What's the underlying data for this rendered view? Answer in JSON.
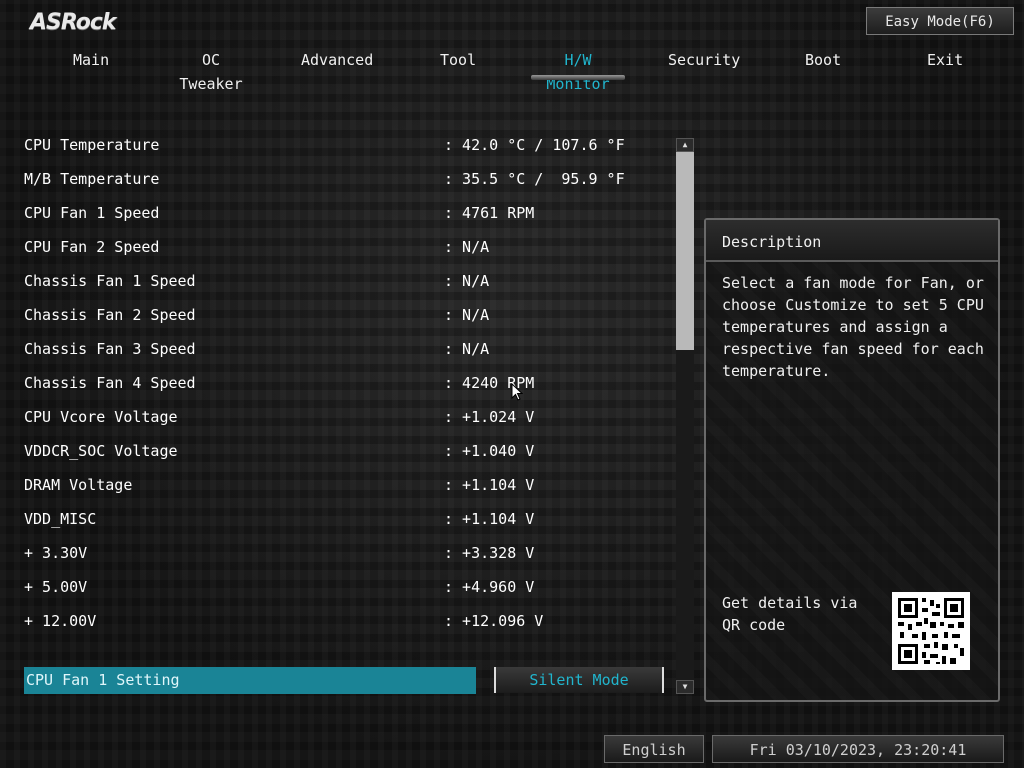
{
  "header": {
    "logo": "ASRock",
    "easy_mode": "Easy Mode(F6)"
  },
  "nav": {
    "tabs": [
      {
        "label": "Main"
      },
      {
        "label": "OC Tweaker"
      },
      {
        "label": "Advanced"
      },
      {
        "label": "Tool"
      },
      {
        "label": "H/W Monitor",
        "active": true
      },
      {
        "label": "Security"
      },
      {
        "label": "Boot"
      },
      {
        "label": "Exit"
      }
    ]
  },
  "monitor": {
    "rows": [
      {
        "label": "CPU Temperature",
        "value": ": 42.0 °C / 107.6 °F"
      },
      {
        "label": "M/B Temperature",
        "value": ": 35.5 °C /  95.9 °F"
      },
      {
        "label": "CPU Fan 1 Speed",
        "value": ": 4761 RPM"
      },
      {
        "label": "CPU Fan 2 Speed",
        "value": ": N/A"
      },
      {
        "label": "Chassis Fan 1 Speed",
        "value": ": N/A"
      },
      {
        "label": "Chassis Fan 2 Speed",
        "value": ": N/A"
      },
      {
        "label": "Chassis Fan 3 Speed",
        "value": ": N/A"
      },
      {
        "label": "Chassis Fan 4 Speed",
        "value": ": 4240 RPM"
      },
      {
        "label": "CPU Vcore Voltage",
        "value": ": +1.024 V"
      },
      {
        "label": "VDDCR_SOC Voltage",
        "value": ": +1.040 V"
      },
      {
        "label": "DRAM Voltage",
        "value": ": +1.104 V"
      },
      {
        "label": "VDD_MISC",
        "value": ": +1.104 V"
      },
      {
        "label": "+ 3.30V",
        "value": ": +3.328 V"
      },
      {
        "label": "+ 5.00V",
        "value": ": +4.960 V"
      },
      {
        "label": "+ 12.00V",
        "value": ": +12.096 V"
      }
    ],
    "setting_label": "CPU Fan 1 Setting",
    "setting_value": "Silent Mode"
  },
  "description": {
    "title": "Description",
    "text": "Select a fan mode for Fan, or choose Customize to set 5 CPU temperatures and assign a respective fan speed for each temperature.",
    "qr_text": "Get details via QR code"
  },
  "footer": {
    "language": "English",
    "datetime": "Fri 03/10/2023, 23:20:41"
  },
  "colors": {
    "accent": "#21b5cd",
    "selection": "#1a8496"
  }
}
